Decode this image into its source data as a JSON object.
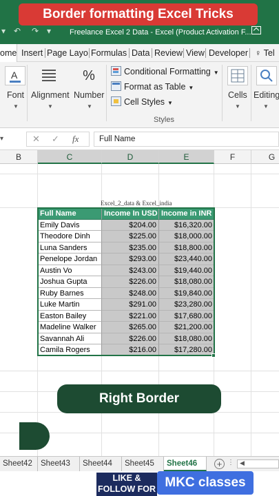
{
  "banner": "Border formatting Excel Tricks",
  "window_title": "Freelance Excel 2 Data - Excel (Product Activation F...",
  "ribbon_tabs": [
    "ome",
    "Insert",
    "Page Layo",
    "Formulas",
    "Data",
    "Review",
    "View",
    "Developer",
    "Tel"
  ],
  "active_tab": "ome",
  "ribbon": {
    "font_label": "Font",
    "alignment_label": "Alignment",
    "number_label": "Number",
    "number_icon": "%",
    "conditional_formatting": "Conditional Formatting",
    "format_as_table": "Format as Table",
    "cell_styles": "Cell Styles",
    "styles_label": "Styles",
    "cells_label": "Cells",
    "editing_label": "Editing"
  },
  "formula_bar": {
    "formula": "Full Name",
    "fx": "fx"
  },
  "columns": [
    "B",
    "C",
    "D",
    "E",
    "F",
    "G"
  ],
  "sheet": {
    "caption": "Excel_2_data & Excel_india",
    "headers": [
      "Full Name",
      "Income In USD",
      "Income in INR"
    ],
    "rows": [
      [
        "Emily Davis",
        "$204.00",
        "$16,320.00"
      ],
      [
        "Theodore Dinh",
        "$225.00",
        "$18,000.00"
      ],
      [
        "Luna Sanders",
        "$235.00",
        "$18,800.00"
      ],
      [
        "Penelope Jordan",
        "$293.00",
        "$23,440.00"
      ],
      [
        "Austin Vo",
        "$243.00",
        "$19,440.00"
      ],
      [
        "Joshua Gupta",
        "$226.00",
        "$18,080.00"
      ],
      [
        "Ruby Barnes",
        "$248.00",
        "$19,840.00"
      ],
      [
        "Luke Martin",
        "$291.00",
        "$23,280.00"
      ],
      [
        "Easton Bailey",
        "$221.00",
        "$17,680.00"
      ],
      [
        "Madeline Walker",
        "$265.00",
        "$21,200.00"
      ],
      [
        "Savannah Ali",
        "$226.00",
        "$18,080.00"
      ],
      [
        "Camila Rogers",
        "$216.00",
        "$17,280.00"
      ]
    ]
  },
  "overlay_label": "Right Border",
  "sheet_tabs": [
    "Sheet42",
    "Sheet43",
    "Sheet44",
    "Sheet45",
    "Sheet46"
  ],
  "active_sheet": "Sheet46",
  "footer": {
    "like_text": "LIKE & FOLLOW FOR MO",
    "brand": "MKC classes"
  },
  "colors": {
    "excel_green": "#217346",
    "banner_red": "#d93a35",
    "header_green": "#3b9a73",
    "selection_gray": "#c9c9c9",
    "brand_blue": "#3f6fe0"
  }
}
